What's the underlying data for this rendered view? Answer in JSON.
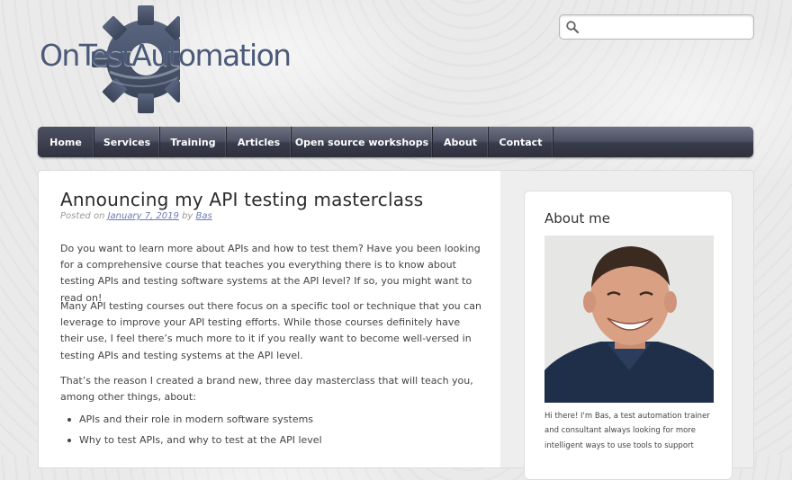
{
  "site": {
    "logo_text": "OnTestAutomation"
  },
  "search": {
    "placeholder": "",
    "value": ""
  },
  "nav": {
    "items": [
      {
        "label": "Home"
      },
      {
        "label": "Services"
      },
      {
        "label": "Training"
      },
      {
        "label": "Articles"
      },
      {
        "label": "Open source workshops"
      },
      {
        "label": "About"
      },
      {
        "label": "Contact"
      }
    ],
    "active_index": 0
  },
  "post": {
    "title": "Announcing my API testing masterclass",
    "meta_prefix": "Posted on",
    "date": "January 7, 2019",
    "meta_by": "by",
    "author": "Bas",
    "paragraphs": [
      "Do you want to learn more about APIs and how to test them? Have you been looking for a comprehensive course that teaches you everything there is to know about testing APIs and testing software systems at the API level? If so, you might want to read on!",
      "Many API testing courses out there focus on a specific tool or technique that you can leverage to improve your API testing efforts. While those courses definitely have their use, I feel there’s much more to it if you really want to become well-versed in testing APIs and testing systems at the API level.",
      "That’s the reason I created a brand new, three day masterclass that will teach you, among other things, about:"
    ],
    "bullets": [
      "APIs and their role in modern software systems",
      "Why to test APIs, and why to test at the API level"
    ]
  },
  "sidebar": {
    "widget_title": "About me",
    "bio": "Hi there! I'm Bas, a test automation trainer and consultant always looking for more intelligent ways to use tools to support"
  },
  "colors": {
    "logo_text": "#4b5a78",
    "gear": "#4a5670",
    "nav_dark": "#2e303c",
    "link": "#6b7bb0"
  },
  "icons": {
    "search": "search-icon",
    "gear": "gear-icon"
  }
}
